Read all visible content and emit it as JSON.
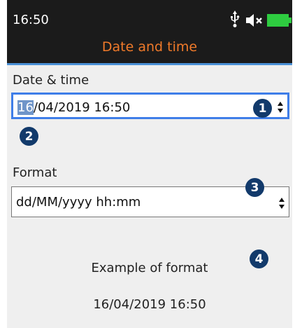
{
  "status": {
    "time": "16:50",
    "icons": [
      "usb-icon",
      "mute-icon",
      "battery-icon"
    ],
    "battery_color": "#2ecc40"
  },
  "header": {
    "title": "Date and time"
  },
  "datetime": {
    "label": "Date & time",
    "selected_segment": "16",
    "rest": "/04/2019 16:50"
  },
  "format": {
    "label": "Format",
    "value": "dd/MM/yyyy hh:mm"
  },
  "example": {
    "label": "Example of format",
    "value": "16/04/2019 16:50"
  },
  "callouts": [
    "1",
    "2",
    "3",
    "4"
  ],
  "colors": {
    "accent": "#f07a2a",
    "focus": "#3f7ee8",
    "badge": "#123a6b"
  }
}
